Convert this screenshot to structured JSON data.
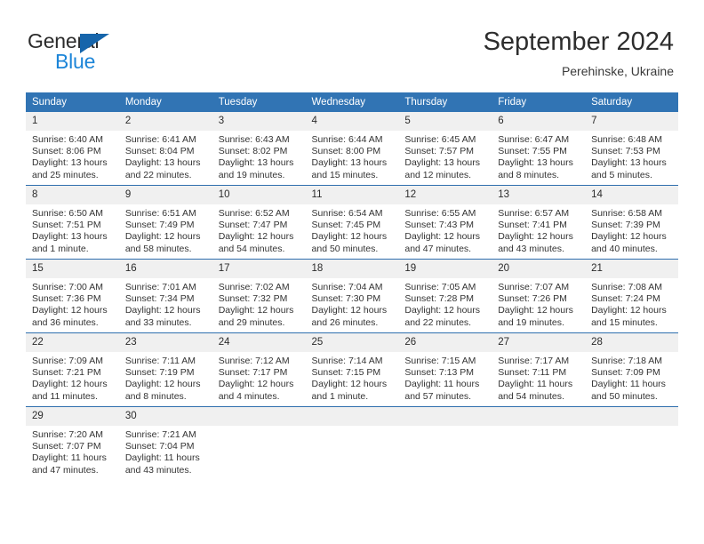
{
  "brand": {
    "name_part1": "General",
    "name_part2": "Blue",
    "triangle_color": "#1665ab",
    "blue_text_color": "#1c85d8"
  },
  "header": {
    "month_title": "September 2024",
    "location": "Perehinske, Ukraine"
  },
  "colors": {
    "header_blue": "#3174b4",
    "row_divider_blue": "#2f6fae",
    "daynum_background": "#f0f0f0",
    "text": "#333333"
  },
  "calendar": {
    "weekday_headers": [
      "Sunday",
      "Monday",
      "Tuesday",
      "Wednesday",
      "Thursday",
      "Friday",
      "Saturday"
    ],
    "weeks": [
      [
        {
          "day": "1",
          "sunrise": "Sunrise: 6:40 AM",
          "sunset": "Sunset: 8:06 PM",
          "daylight1": "Daylight: 13 hours",
          "daylight2": "and 25 minutes."
        },
        {
          "day": "2",
          "sunrise": "Sunrise: 6:41 AM",
          "sunset": "Sunset: 8:04 PM",
          "daylight1": "Daylight: 13 hours",
          "daylight2": "and 22 minutes."
        },
        {
          "day": "3",
          "sunrise": "Sunrise: 6:43 AM",
          "sunset": "Sunset: 8:02 PM",
          "daylight1": "Daylight: 13 hours",
          "daylight2": "and 19 minutes."
        },
        {
          "day": "4",
          "sunrise": "Sunrise: 6:44 AM",
          "sunset": "Sunset: 8:00 PM",
          "daylight1": "Daylight: 13 hours",
          "daylight2": "and 15 minutes."
        },
        {
          "day": "5",
          "sunrise": "Sunrise: 6:45 AM",
          "sunset": "Sunset: 7:57 PM",
          "daylight1": "Daylight: 13 hours",
          "daylight2": "and 12 minutes."
        },
        {
          "day": "6",
          "sunrise": "Sunrise: 6:47 AM",
          "sunset": "Sunset: 7:55 PM",
          "daylight1": "Daylight: 13 hours",
          "daylight2": "and 8 minutes."
        },
        {
          "day": "7",
          "sunrise": "Sunrise: 6:48 AM",
          "sunset": "Sunset: 7:53 PM",
          "daylight1": "Daylight: 13 hours",
          "daylight2": "and 5 minutes."
        }
      ],
      [
        {
          "day": "8",
          "sunrise": "Sunrise: 6:50 AM",
          "sunset": "Sunset: 7:51 PM",
          "daylight1": "Daylight: 13 hours",
          "daylight2": "and 1 minute."
        },
        {
          "day": "9",
          "sunrise": "Sunrise: 6:51 AM",
          "sunset": "Sunset: 7:49 PM",
          "daylight1": "Daylight: 12 hours",
          "daylight2": "and 58 minutes."
        },
        {
          "day": "10",
          "sunrise": "Sunrise: 6:52 AM",
          "sunset": "Sunset: 7:47 PM",
          "daylight1": "Daylight: 12 hours",
          "daylight2": "and 54 minutes."
        },
        {
          "day": "11",
          "sunrise": "Sunrise: 6:54 AM",
          "sunset": "Sunset: 7:45 PM",
          "daylight1": "Daylight: 12 hours",
          "daylight2": "and 50 minutes."
        },
        {
          "day": "12",
          "sunrise": "Sunrise: 6:55 AM",
          "sunset": "Sunset: 7:43 PM",
          "daylight1": "Daylight: 12 hours",
          "daylight2": "and 47 minutes."
        },
        {
          "day": "13",
          "sunrise": "Sunrise: 6:57 AM",
          "sunset": "Sunset: 7:41 PM",
          "daylight1": "Daylight: 12 hours",
          "daylight2": "and 43 minutes."
        },
        {
          "day": "14",
          "sunrise": "Sunrise: 6:58 AM",
          "sunset": "Sunset: 7:39 PM",
          "daylight1": "Daylight: 12 hours",
          "daylight2": "and 40 minutes."
        }
      ],
      [
        {
          "day": "15",
          "sunrise": "Sunrise: 7:00 AM",
          "sunset": "Sunset: 7:36 PM",
          "daylight1": "Daylight: 12 hours",
          "daylight2": "and 36 minutes."
        },
        {
          "day": "16",
          "sunrise": "Sunrise: 7:01 AM",
          "sunset": "Sunset: 7:34 PM",
          "daylight1": "Daylight: 12 hours",
          "daylight2": "and 33 minutes."
        },
        {
          "day": "17",
          "sunrise": "Sunrise: 7:02 AM",
          "sunset": "Sunset: 7:32 PM",
          "daylight1": "Daylight: 12 hours",
          "daylight2": "and 29 minutes."
        },
        {
          "day": "18",
          "sunrise": "Sunrise: 7:04 AM",
          "sunset": "Sunset: 7:30 PM",
          "daylight1": "Daylight: 12 hours",
          "daylight2": "and 26 minutes."
        },
        {
          "day": "19",
          "sunrise": "Sunrise: 7:05 AM",
          "sunset": "Sunset: 7:28 PM",
          "daylight1": "Daylight: 12 hours",
          "daylight2": "and 22 minutes."
        },
        {
          "day": "20",
          "sunrise": "Sunrise: 7:07 AM",
          "sunset": "Sunset: 7:26 PM",
          "daylight1": "Daylight: 12 hours",
          "daylight2": "and 19 minutes."
        },
        {
          "day": "21",
          "sunrise": "Sunrise: 7:08 AM",
          "sunset": "Sunset: 7:24 PM",
          "daylight1": "Daylight: 12 hours",
          "daylight2": "and 15 minutes."
        }
      ],
      [
        {
          "day": "22",
          "sunrise": "Sunrise: 7:09 AM",
          "sunset": "Sunset: 7:21 PM",
          "daylight1": "Daylight: 12 hours",
          "daylight2": "and 11 minutes."
        },
        {
          "day": "23",
          "sunrise": "Sunrise: 7:11 AM",
          "sunset": "Sunset: 7:19 PM",
          "daylight1": "Daylight: 12 hours",
          "daylight2": "and 8 minutes."
        },
        {
          "day": "24",
          "sunrise": "Sunrise: 7:12 AM",
          "sunset": "Sunset: 7:17 PM",
          "daylight1": "Daylight: 12 hours",
          "daylight2": "and 4 minutes."
        },
        {
          "day": "25",
          "sunrise": "Sunrise: 7:14 AM",
          "sunset": "Sunset: 7:15 PM",
          "daylight1": "Daylight: 12 hours",
          "daylight2": "and 1 minute."
        },
        {
          "day": "26",
          "sunrise": "Sunrise: 7:15 AM",
          "sunset": "Sunset: 7:13 PM",
          "daylight1": "Daylight: 11 hours",
          "daylight2": "and 57 minutes."
        },
        {
          "day": "27",
          "sunrise": "Sunrise: 7:17 AM",
          "sunset": "Sunset: 7:11 PM",
          "daylight1": "Daylight: 11 hours",
          "daylight2": "and 54 minutes."
        },
        {
          "day": "28",
          "sunrise": "Sunrise: 7:18 AM",
          "sunset": "Sunset: 7:09 PM",
          "daylight1": "Daylight: 11 hours",
          "daylight2": "and 50 minutes."
        }
      ],
      [
        {
          "day": "29",
          "sunrise": "Sunrise: 7:20 AM",
          "sunset": "Sunset: 7:07 PM",
          "daylight1": "Daylight: 11 hours",
          "daylight2": "and 47 minutes."
        },
        {
          "day": "30",
          "sunrise": "Sunrise: 7:21 AM",
          "sunset": "Sunset: 7:04 PM",
          "daylight1": "Daylight: 11 hours",
          "daylight2": "and 43 minutes."
        },
        {
          "day": "",
          "sunrise": "",
          "sunset": "",
          "daylight1": "",
          "daylight2": ""
        },
        {
          "day": "",
          "sunrise": "",
          "sunset": "",
          "daylight1": "",
          "daylight2": ""
        },
        {
          "day": "",
          "sunrise": "",
          "sunset": "",
          "daylight1": "",
          "daylight2": ""
        },
        {
          "day": "",
          "sunrise": "",
          "sunset": "",
          "daylight1": "",
          "daylight2": ""
        },
        {
          "day": "",
          "sunrise": "",
          "sunset": "",
          "daylight1": "",
          "daylight2": ""
        }
      ]
    ]
  }
}
